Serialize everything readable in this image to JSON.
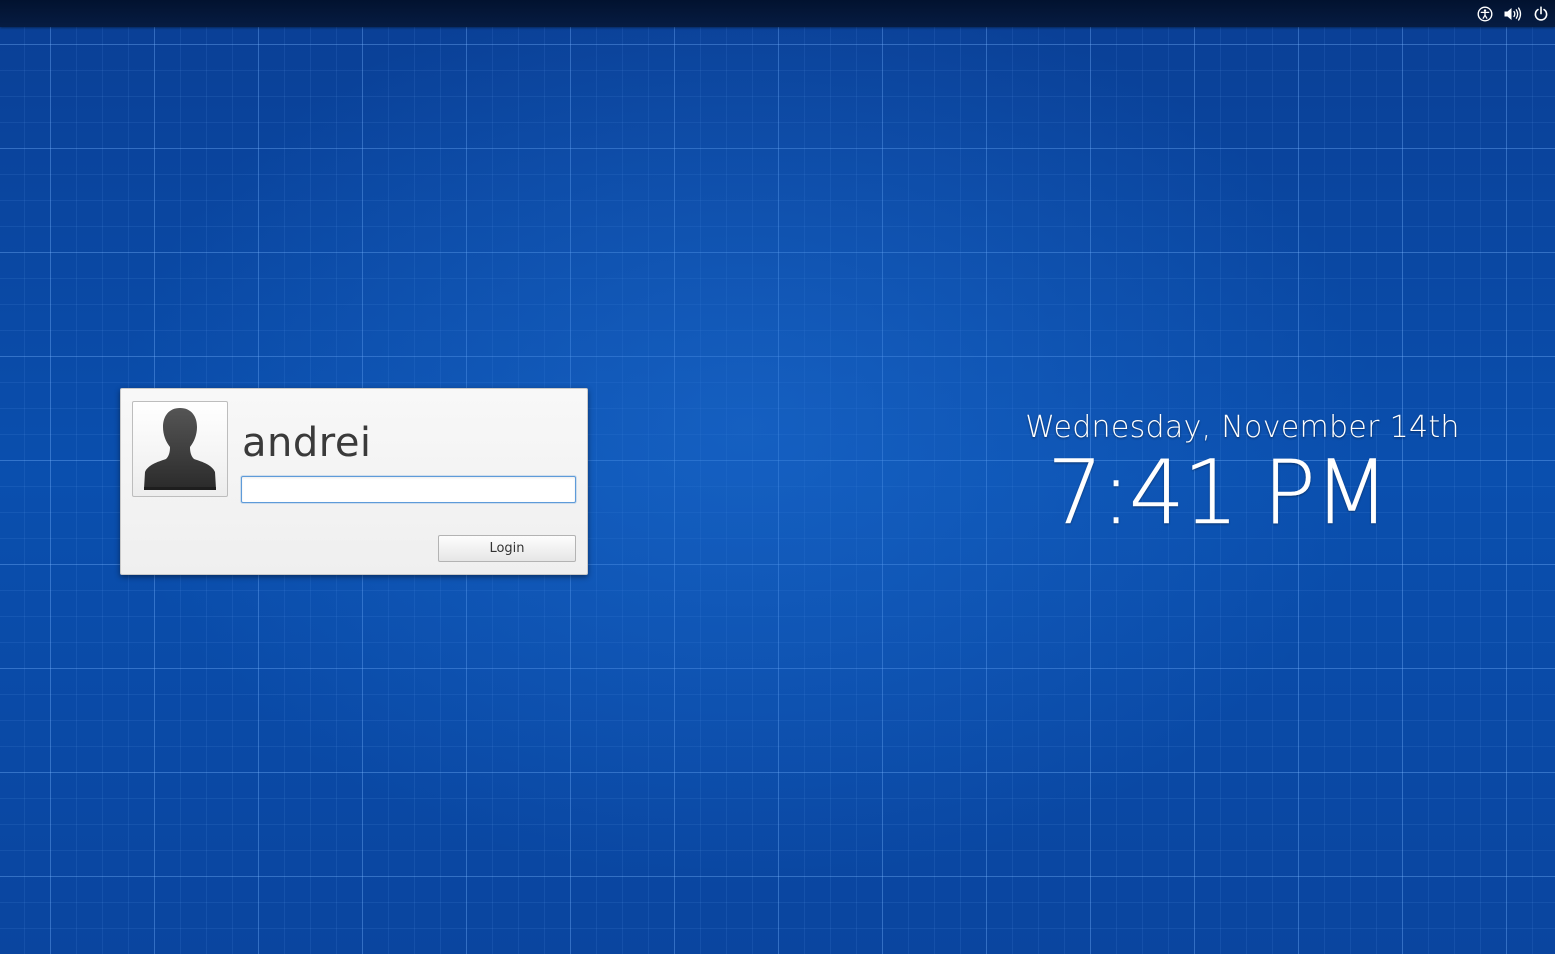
{
  "top_panel": {
    "indicators": [
      {
        "icon": "accessibility-icon"
      },
      {
        "icon": "volume-icon"
      },
      {
        "icon": "power-icon"
      }
    ]
  },
  "login": {
    "username": "andrei",
    "password_value": "",
    "password_placeholder": "",
    "button_label": "Login",
    "avatar_icon": "user-silhouette-icon"
  },
  "clock": {
    "date": "Wednesday, November 14th",
    "time": "7:41 PM"
  },
  "colors": {
    "background": "#0a4ca6",
    "panel": "#041733",
    "card": "#f4f4f4",
    "input_focus": "#5e9bd9"
  }
}
